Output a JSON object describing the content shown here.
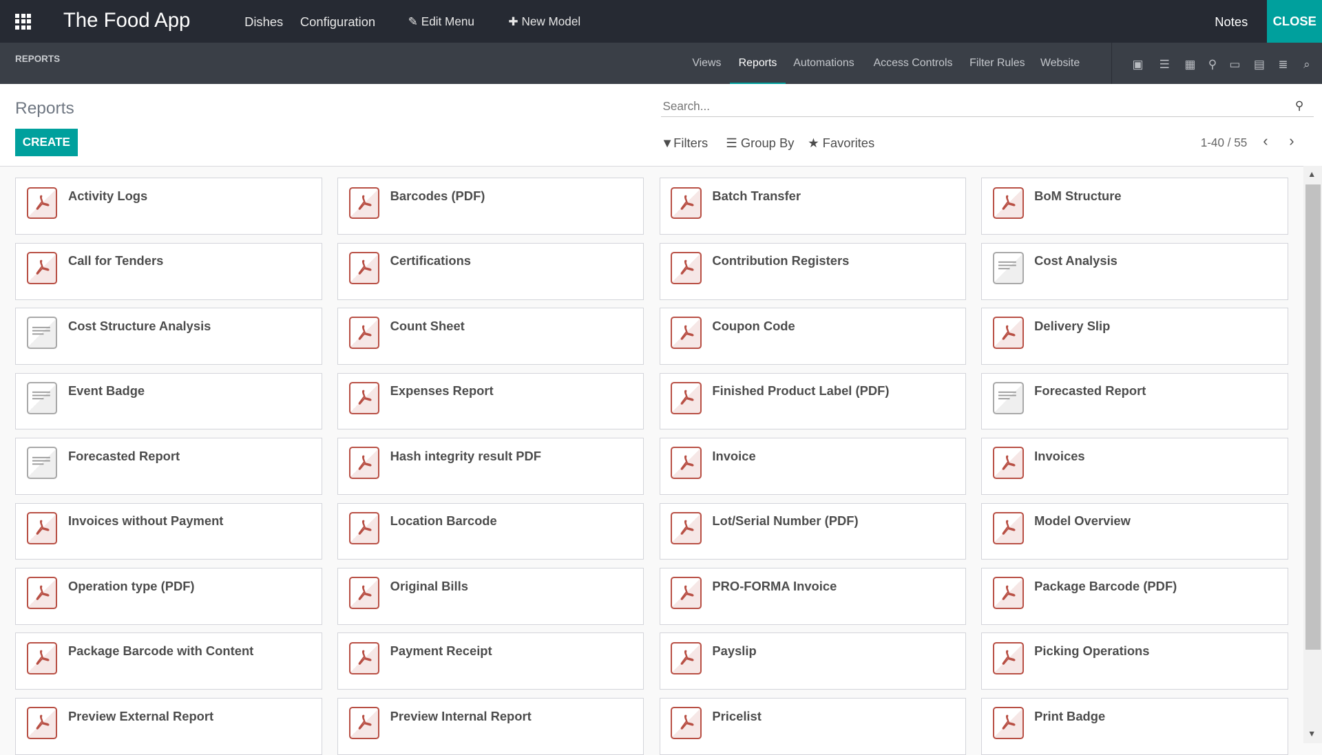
{
  "topbar": {
    "app_name": "The Food App",
    "menus": [
      "Dishes",
      "Configuration"
    ],
    "edit_menu": "Edit Menu",
    "new_model": "New Model",
    "notes": "Notes",
    "close": "CLOSE"
  },
  "subbar": {
    "breadcrumb": "REPORTS",
    "tabs": [
      "Views",
      "Reports",
      "Automations",
      "Access Controls",
      "Filter Rules",
      "Website"
    ],
    "active_tab": "Reports",
    "view_icons": [
      "kanban-icon",
      "list-icon",
      "grid-icon",
      "map-pin-icon",
      "calendar-icon",
      "pivot-icon",
      "form-icon",
      "search-icon"
    ]
  },
  "control": {
    "title": "Reports",
    "create": "CREATE",
    "search_placeholder": "Search...",
    "filters": "Filters",
    "group_by": "Group By",
    "favorites": "Favorites",
    "pager": "1-40 / 55"
  },
  "colors": {
    "accent": "#00a09d",
    "topbar": "#262a33",
    "subbar": "#3a3f47",
    "pdf": "#b84f44"
  },
  "reports": [
    {
      "name": "Activity Logs",
      "type": "pdf"
    },
    {
      "name": "Barcodes (PDF)",
      "type": "pdf"
    },
    {
      "name": "Batch Transfer",
      "type": "pdf"
    },
    {
      "name": "BoM Structure",
      "type": "pdf"
    },
    {
      "name": "Call for Tenders",
      "type": "pdf"
    },
    {
      "name": "Certifications",
      "type": "pdf"
    },
    {
      "name": "Contribution Registers",
      "type": "pdf"
    },
    {
      "name": "Cost Analysis",
      "type": "html"
    },
    {
      "name": "Cost Structure Analysis",
      "type": "html"
    },
    {
      "name": "Count Sheet",
      "type": "pdf"
    },
    {
      "name": "Coupon Code",
      "type": "pdf"
    },
    {
      "name": "Delivery Slip",
      "type": "pdf"
    },
    {
      "name": "Event Badge",
      "type": "html"
    },
    {
      "name": "Expenses Report",
      "type": "pdf"
    },
    {
      "name": "Finished Product Label (PDF)",
      "type": "pdf"
    },
    {
      "name": "Forecasted Report",
      "type": "html"
    },
    {
      "name": "Forecasted Report",
      "type": "html"
    },
    {
      "name": "Hash integrity result PDF",
      "type": "pdf"
    },
    {
      "name": "Invoice",
      "type": "pdf"
    },
    {
      "name": "Invoices",
      "type": "pdf"
    },
    {
      "name": "Invoices without Payment",
      "type": "pdf"
    },
    {
      "name": "Location Barcode",
      "type": "pdf"
    },
    {
      "name": "Lot/Serial Number (PDF)",
      "type": "pdf"
    },
    {
      "name": "Model Overview",
      "type": "pdf"
    },
    {
      "name": "Operation type (PDF)",
      "type": "pdf"
    },
    {
      "name": "Original Bills",
      "type": "pdf"
    },
    {
      "name": "PRO-FORMA Invoice",
      "type": "pdf"
    },
    {
      "name": "Package Barcode (PDF)",
      "type": "pdf"
    },
    {
      "name": "Package Barcode with Content",
      "type": "pdf"
    },
    {
      "name": "Payment Receipt",
      "type": "pdf"
    },
    {
      "name": "Payslip",
      "type": "pdf"
    },
    {
      "name": "Picking Operations",
      "type": "pdf"
    },
    {
      "name": "Preview External Report",
      "type": "pdf"
    },
    {
      "name": "Preview Internal Report",
      "type": "pdf"
    },
    {
      "name": "Pricelist",
      "type": "pdf"
    },
    {
      "name": "Print Badge",
      "type": "pdf"
    }
  ]
}
